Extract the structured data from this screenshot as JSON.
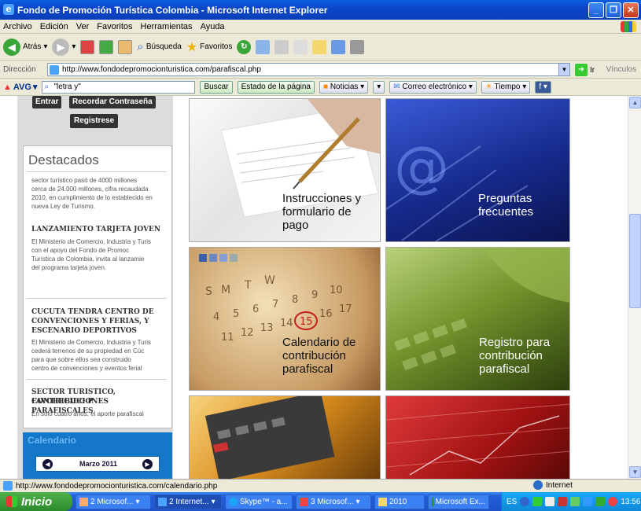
{
  "window": {
    "title": "Fondo de Promoción Turística Colombia - Microsoft Internet Explorer"
  },
  "menu": [
    "Archivo",
    "Edición",
    "Ver",
    "Favoritos",
    "Herramientas",
    "Ayuda"
  ],
  "toolbar": {
    "back": "Atrás",
    "search": "Búsqueda",
    "favorites": "Favoritos"
  },
  "address": {
    "label": "Dirección",
    "url": "http://www.fondodepromocionturistica.com/parafiscal.php",
    "go": "Ir",
    "links": "Vínculos"
  },
  "avgbar": {
    "logo": "AVG",
    "search_value": "\"letra y\"",
    "buscar": "Buscar",
    "estado": "Estado de la página",
    "noticias": "Noticias",
    "correo": "Correo electrónico",
    "tiempo": "Tiempo"
  },
  "sidebar": {
    "entrar": "Entrar",
    "recordar": "Recordar Contraseña",
    "registrese": "Registrese",
    "destacados_title": "Destacados",
    "intro_lines": [
      "sector turístico pasó de 4000 millones",
      "cerca de 24.000 millones, cifra recaudada",
      "2010, en cumplimiento de lo establecido en",
      "nueva Ley de Turismo."
    ],
    "news": [
      {
        "title_lines": [
          "LANZAMIENTO TARJETA JOVEN"
        ],
        "body_lines": [
          "El Ministerio de Comercio, Industria y Turis",
          "con el apoyo del Fondo de Promoc",
          "Turística de Colombia, invita al lanzamie",
          "del programa tarjeta joven."
        ]
      },
      {
        "title_lines": [
          "CUCUTA TENDRA CENTRO DE",
          "CONVENCIONES Y FERIAS, Y",
          "ESCENARIO DEPORTIVOS"
        ],
        "body_lines": [
          "El Ministerio de Comercio, Industria y Turis",
          "cederá terrenos de su propiedad en Cúc",
          "para que sobre ellos sea construido",
          "centro de convenciones y eventos ferial"
        ]
      },
      {
        "title_lines": [
          "SECTOR TURISTICO, FAVORECIDO P",
          "CONTRIBUCIONES PARAFISCALES"
        ],
        "body_lines": [
          "En sólo cuatro años, el aporte parafiscal"
        ]
      }
    ],
    "calendar_title": "Calendario",
    "calendar_month": "Marzo 2011"
  },
  "tiles": [
    {
      "caption_lines": [
        "Instrucciones y",
        "formulario de",
        "pago"
      ]
    },
    {
      "caption_lines": [
        "Preguntas",
        "frecuentes"
      ]
    },
    {
      "caption_lines": [
        "Calendario de",
        "contribución",
        "parafiscal"
      ]
    },
    {
      "caption_lines": [
        "Registro para",
        "contribución",
        "parafiscal"
      ]
    }
  ],
  "status": {
    "url": "http://www.fondodepromocionturistica.com/calendario.php",
    "zone": "Internet"
  },
  "taskbar": {
    "start": "Inicio",
    "tasks": [
      "2 Microsof...",
      "2 Internet...",
      "Skype™ - a...",
      "3 Microsof...",
      "2010",
      "Microsoft Ex..."
    ],
    "lang": "ES",
    "clock": "13:56"
  },
  "colors": {
    "xp_blue": "#0b46c8",
    "start_green": "#3a9b37",
    "calendar_blue": "#1477c8"
  }
}
